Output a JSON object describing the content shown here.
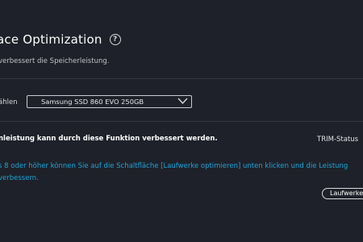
{
  "header": {
    "title": "ace Optimization",
    "help_icon_text": "?",
    "subtitle": "verbessert die Speicherleistung."
  },
  "drive_selection": {
    "label": "ählen",
    "selected_drive": "Samsung SSD 860 EVO 250GB",
    "chevron_icon": "chevron-down-icon"
  },
  "info": {
    "heading": "nleistung kann durch diese Funktion verbessert werden.",
    "trim_label": "TRIM-Status",
    "description_line1": "s 8 oder höher können Sie auf die Schaltfläche [Laufwerke optimieren] unten klicken und die Leistung",
    "description_line2": "verbessern.",
    "link_color": "#1fa3d8"
  },
  "actions": {
    "optimize_label": "Laufwerke optimieren"
  },
  "colors": {
    "background": "#1e2129",
    "divider": "#343843",
    "text_primary": "#ffffff",
    "text_secondary": "#bfc2c8"
  }
}
